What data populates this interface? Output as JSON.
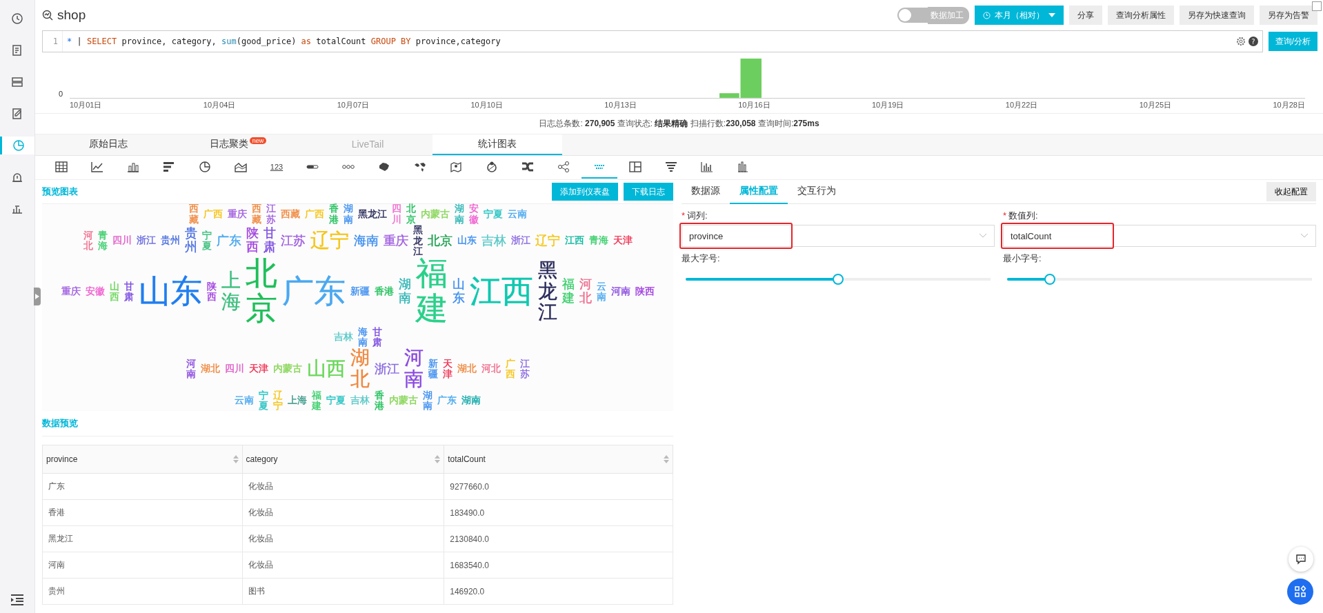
{
  "sidebar": {
    "items": [
      {
        "kind": "clock",
        "selected": false
      },
      {
        "kind": "document",
        "selected": false
      },
      {
        "kind": "database",
        "selected": false
      },
      {
        "kind": "edit",
        "selected": false
      },
      {
        "kind": "chart",
        "selected": true
      },
      {
        "kind": "alarm",
        "selected": false
      },
      {
        "kind": "dashboard",
        "selected": false
      }
    ]
  },
  "header": {
    "title": "shop",
    "toggle": {
      "label": "数据加工",
      "on": false
    },
    "time_button": "本月（相对）",
    "buttons": [
      "分享",
      "查询分析属性",
      "另存为快速查询",
      "另存为告警"
    ]
  },
  "query": {
    "line_number": "1",
    "tokens": [
      {
        "kind": "op",
        "text": "*"
      },
      {
        "kind": "plain",
        "text": " | "
      },
      {
        "kind": "keyword",
        "text": "SELECT"
      },
      {
        "kind": "plain",
        "text": " province, category, "
      },
      {
        "kind": "func",
        "text": "sum"
      },
      {
        "kind": "plain",
        "text": "(good_price) "
      },
      {
        "kind": "keyword",
        "text": "as"
      },
      {
        "kind": "plain",
        "text": " totalCount "
      },
      {
        "kind": "keyword",
        "text": "GROUP BY"
      },
      {
        "kind": "plain",
        "text": " province,category"
      }
    ],
    "help": "?",
    "submit": "查询/分析"
  },
  "histogram": {
    "y_label": "0",
    "x_labels": [
      "10月01日",
      "10月04日",
      "10月07日",
      "10月10日",
      "10月13日",
      "10月16日",
      "10月19日",
      "10月22日",
      "10月25日",
      "10月28日"
    ]
  },
  "stats": "日志总条数: **270,905**  查询状态: **结果精确**  扫描行数:**230,058**  查询时间:**275ms**",
  "tabs": [
    {
      "label": "原始日志",
      "selected": false,
      "disabled": false
    },
    {
      "label": "日志聚类",
      "selected": false,
      "disabled": false,
      "badge": "new"
    },
    {
      "label": "LiveTail",
      "selected": false,
      "disabled": true
    },
    {
      "label": "统计图表",
      "selected": true,
      "disabled": false
    }
  ],
  "chart_types": [
    {
      "kind": "table",
      "selected": false
    },
    {
      "kind": "line",
      "selected": false
    },
    {
      "kind": "bar",
      "selected": false
    },
    {
      "kind": "hbar",
      "selected": false
    },
    {
      "kind": "pie",
      "selected": false
    },
    {
      "kind": "area",
      "selected": false
    },
    {
      "kind": "number",
      "label": "123",
      "selected": false
    },
    {
      "kind": "progress",
      "selected": false
    },
    {
      "kind": "dots",
      "selected": false
    },
    {
      "kind": "map",
      "selected": false
    },
    {
      "kind": "world",
      "selected": false
    },
    {
      "kind": "pin",
      "selected": false
    },
    {
      "kind": "chord",
      "selected": false
    },
    {
      "kind": "sankey",
      "selected": false
    },
    {
      "kind": "tree",
      "selected": false
    },
    {
      "kind": "cloud",
      "selected": true
    },
    {
      "kind": "treemap",
      "selected": false
    },
    {
      "kind": "funnel",
      "selected": false
    },
    {
      "kind": "columns",
      "selected": false
    },
    {
      "kind": "histogram",
      "selected": false
    }
  ],
  "preview": {
    "title": "预览图表",
    "buttons": [
      "添加到仪表盘",
      "下载日志"
    ],
    "word_rows": [
      [
        {
          "text": "西藏",
          "kind": "small",
          "rotated": true,
          "color": "#f0883e"
        },
        {
          "text": "广西",
          "kind": "small",
          "rotated": false,
          "color": "#f5c518"
        },
        {
          "text": "重庆",
          "kind": "small",
          "rotated": false,
          "color": "#a05ee0"
        },
        {
          "text": "西藏",
          "kind": "small",
          "rotated": true,
          "color": "#f0883e"
        },
        {
          "text": "江苏",
          "kind": "small",
          "rotated": true,
          "color": "#a05ee0"
        },
        {
          "text": "西藏",
          "kind": "small",
          "rotated": false,
          "color": "#f0883e"
        },
        {
          "text": "广西",
          "kind": "small",
          "rotated": false,
          "color": "#f5c518"
        },
        {
          "text": "香港",
          "kind": "small",
          "rotated": true,
          "color": "#1fbf5a"
        },
        {
          "text": "湖南",
          "kind": "small",
          "rotated": true,
          "color": "#3d8ef0"
        },
        {
          "text": "黑龙江",
          "kind": "small",
          "rotated": false,
          "color": "#2a2a5a"
        },
        {
          "text": "四川",
          "kind": "small",
          "rotated": true,
          "color": "#f06dd0"
        },
        {
          "text": "北京",
          "kind": "small",
          "rotated": true,
          "color": "#1fbf5a"
        },
        {
          "text": "内蒙古",
          "kind": "small",
          "rotated": false,
          "color": "#8ad65a"
        },
        {
          "text": "湖南",
          "kind": "small",
          "rotated": true,
          "color": "#2ab4b4"
        },
        {
          "text": "安徽",
          "kind": "small",
          "rotated": true,
          "color": "#f060d0"
        },
        {
          "text": "宁夏",
          "kind": "small",
          "rotated": false,
          "color": "#2ac4c4"
        },
        {
          "text": "云南",
          "kind": "small",
          "rotated": false,
          "color": "#4aa8f0"
        }
      ],
      [
        {
          "text": "河北",
          "kind": "small",
          "rotated": true,
          "color": "#f06d8c"
        },
        {
          "text": "青海",
          "kind": "small",
          "rotated": true,
          "color": "#3dcf6e"
        },
        {
          "text": "四川",
          "kind": "small",
          "rotated": false,
          "color": "#e060c8"
        },
        {
          "text": "浙江",
          "kind": "small",
          "rotated": false,
          "color": "#6a6de0"
        },
        {
          "text": "贵州",
          "kind": "small",
          "rotated": false,
          "color": "#4a6ee0"
        },
        {
          "text": "贵州",
          "kind": "medium",
          "rotated": true,
          "color": "#4a6ee0"
        },
        {
          "text": "宁夏",
          "kind": "small",
          "rotated": true,
          "color": "#3dbf7e"
        },
        {
          "text": "广东",
          "kind": "medium",
          "rotated": false,
          "color": "#4aa8f0"
        },
        {
          "text": "陕西",
          "kind": "medium",
          "rotated": true,
          "color": "#a040e0"
        },
        {
          "text": "甘肃",
          "kind": "medium",
          "rotated": true,
          "color": "#7a4ae0"
        },
        {
          "text": "江苏",
          "kind": "medium",
          "rotated": false,
          "color": "#a05ee0"
        },
        {
          "text": "辽宁",
          "kind": "large",
          "rotated": false,
          "color": "#f5c518"
        },
        {
          "text": "海南",
          "kind": "medium",
          "rotated": false,
          "color": "#3d8ef0"
        },
        {
          "text": "重庆",
          "kind": "medium",
          "rotated": false,
          "color": "#a05ee0"
        },
        {
          "text": "黑龙江",
          "kind": "small",
          "rotated": true,
          "color": "#2a2a5a"
        },
        {
          "text": "北京",
          "kind": "medium",
          "rotated": false,
          "color": "#1fa050"
        },
        {
          "text": "山东",
          "kind": "small",
          "rotated": false,
          "color": "#3d8ef0"
        },
        {
          "text": "吉林",
          "kind": "medium",
          "rotated": false,
          "color": "#5ac8c8"
        },
        {
          "text": "浙江",
          "kind": "small",
          "rotated": false,
          "color": "#8a6ae0"
        },
        {
          "text": "辽宁",
          "kind": "medium",
          "rotated": false,
          "color": "#f5c518"
        },
        {
          "text": "江西",
          "kind": "small",
          "rotated": false,
          "color": "#10b8a0"
        },
        {
          "text": "青海",
          "kind": "small",
          "rotated": false,
          "color": "#3dcf6e"
        },
        {
          "text": "天津",
          "kind": "small",
          "rotated": false,
          "color": "#f03050"
        }
      ],
      [
        {
          "text": "重庆",
          "kind": "small",
          "rotated": false,
          "color": "#a05ee0"
        },
        {
          "text": "安徽",
          "kind": "small",
          "rotated": false,
          "color": "#f060d0"
        },
        {
          "text": "山西",
          "kind": "small",
          "rotated": true,
          "color": "#6ad65a"
        },
        {
          "text": "甘肃",
          "kind": "small",
          "rotated": true,
          "color": "#7a4ae0"
        },
        {
          "text": "山东",
          "kind": "huge",
          "rotated": false,
          "color": "#1f7ef0"
        },
        {
          "text": "陕西",
          "kind": "small",
          "rotated": true,
          "color": "#a040e0"
        },
        {
          "text": "上海",
          "kind": "large",
          "rotated": true,
          "color": "#3dbf7e"
        },
        {
          "text": "北京",
          "kind": "huge",
          "rotated": true,
          "color": "#1fbf5a"
        },
        {
          "text": "广东",
          "kind": "huge",
          "rotated": false,
          "color": "#4aa8f0"
        },
        {
          "text": "新疆",
          "kind": "small",
          "rotated": false,
          "color": "#3d8ef0"
        },
        {
          "text": "香港",
          "kind": "small",
          "rotated": false,
          "color": "#1fbf5a"
        },
        {
          "text": "湖南",
          "kind": "medium",
          "rotated": true,
          "color": "#2ab4b4"
        },
        {
          "text": "福建",
          "kind": "huge",
          "rotated": true,
          "color": "#2ad08a"
        },
        {
          "text": "山东",
          "kind": "medium",
          "rotated": true,
          "color": "#3d8ef0"
        },
        {
          "text": "江西",
          "kind": "huge",
          "rotated": false,
          "color": "#10c8b0"
        },
        {
          "text": "黑龙江",
          "kind": "large",
          "rotated": true,
          "color": "#2a2a5a"
        },
        {
          "text": "福建",
          "kind": "medium",
          "rotated": true,
          "color": "#3dcf6e"
        },
        {
          "text": "河北",
          "kind": "medium",
          "rotated": true,
          "color": "#f06d8c"
        },
        {
          "text": "云南",
          "kind": "small",
          "rotated": true,
          "color": "#4aa8f0"
        },
        {
          "text": "河南",
          "kind": "small",
          "rotated": false,
          "color": "#8a4ae0"
        },
        {
          "text": "陕西",
          "kind": "small",
          "rotated": false,
          "color": "#a040e0"
        },
        {
          "text": "吉林",
          "kind": "small",
          "rotated": false,
          "color": "#5ac8c8"
        },
        {
          "text": "海南",
          "kind": "small",
          "rotated": true,
          "color": "#3d8ef0"
        },
        {
          "text": "甘肃",
          "kind": "small",
          "rotated": true,
          "color": "#7a4ae0"
        }
      ],
      [
        {
          "text": "河南",
          "kind": "small",
          "rotated": true,
          "color": "#8a4ae0"
        },
        {
          "text": "湖北",
          "kind": "small",
          "rotated": false,
          "color": "#f0883e"
        },
        {
          "text": "四川",
          "kind": "small",
          "rotated": false,
          "color": "#e060c8"
        },
        {
          "text": "天津",
          "kind": "small",
          "rotated": false,
          "color": "#f03050"
        },
        {
          "text": "内蒙古",
          "kind": "small",
          "rotated": false,
          "color": "#8ad65a"
        },
        {
          "text": "山西",
          "kind": "large",
          "rotated": false,
          "color": "#6ad65a"
        },
        {
          "text": "湖北",
          "kind": "large",
          "rotated": true,
          "color": "#f0883e"
        },
        {
          "text": "浙江",
          "kind": "medium",
          "rotated": false,
          "color": "#8a6ae0"
        },
        {
          "text": "河南",
          "kind": "large",
          "rotated": true,
          "color": "#8a4ae0"
        },
        {
          "text": "新疆",
          "kind": "small",
          "rotated": true,
          "color": "#3d8ef0"
        },
        {
          "text": "天津",
          "kind": "small",
          "rotated": true,
          "color": "#f03050"
        },
        {
          "text": "湖北",
          "kind": "small",
          "rotated": false,
          "color": "#f0883e"
        },
        {
          "text": "河北",
          "kind": "small",
          "rotated": false,
          "color": "#f06d8c"
        },
        {
          "text": "广西",
          "kind": "small",
          "rotated": true,
          "color": "#f5c518"
        },
        {
          "text": "江苏",
          "kind": "small",
          "rotated": true,
          "color": "#8a6ae0"
        }
      ],
      [
        {
          "text": "云南",
          "kind": "small",
          "rotated": false,
          "color": "#4aa8f0"
        },
        {
          "text": "宁夏",
          "kind": "small",
          "rotated": true,
          "color": "#2ac4c4"
        },
        {
          "text": "辽宁",
          "kind": "small",
          "rotated": true,
          "color": "#f5c518"
        },
        {
          "text": "上海",
          "kind": "small",
          "rotated": false,
          "color": "#3d9a8a"
        },
        {
          "text": "福建",
          "kind": "small",
          "rotated": true,
          "color": "#3dcf6e"
        },
        {
          "text": "宁夏",
          "kind": "small",
          "rotated": false,
          "color": "#2ac4c4"
        },
        {
          "text": "吉林",
          "kind": "small",
          "rotated": false,
          "color": "#5ac8c8"
        },
        {
          "text": "香港",
          "kind": "small",
          "rotated": true,
          "color": "#1fbf5a"
        },
        {
          "text": "内蒙古",
          "kind": "small",
          "rotated": false,
          "color": "#8ad65a"
        },
        {
          "text": "湖南",
          "kind": "small",
          "rotated": true,
          "color": "#3d8ef0"
        },
        {
          "text": "广东",
          "kind": "small",
          "rotated": false,
          "color": "#4aa8f0"
        },
        {
          "text": "湖南",
          "kind": "small",
          "rotated": false,
          "color": "#10a8a8"
        }
      ]
    ]
  },
  "data_preview": {
    "title": "数据预览",
    "columns": [
      "province",
      "category",
      "totalCount"
    ],
    "rows": [
      [
        "广东",
        "化妆品",
        "9277660.0"
      ],
      [
        "香港",
        "化妆品",
        "183490.0"
      ],
      [
        "黑龙江",
        "化妆品",
        "2130840.0"
      ],
      [
        "河南",
        "化妆品",
        "1683540.0"
      ],
      [
        "贵州",
        "图书",
        "146920.0"
      ]
    ]
  },
  "config": {
    "tabs": [
      {
        "label": "数据源",
        "selected": false
      },
      {
        "label": "属性配置",
        "selected": true
      },
      {
        "label": "交互行为",
        "selected": false
      }
    ],
    "collapse_button": "收起配置",
    "fields": [
      {
        "label": "词列:",
        "required": true,
        "value": "province",
        "highlighted": true
      },
      {
        "label": "数值列:",
        "required": true,
        "value": "totalCount",
        "highlighted": true
      }
    ],
    "sliders": [
      {
        "label": "最大字号:",
        "level": 0.5
      },
      {
        "label": "最小字号:",
        "level": 0.14
      }
    ]
  }
}
